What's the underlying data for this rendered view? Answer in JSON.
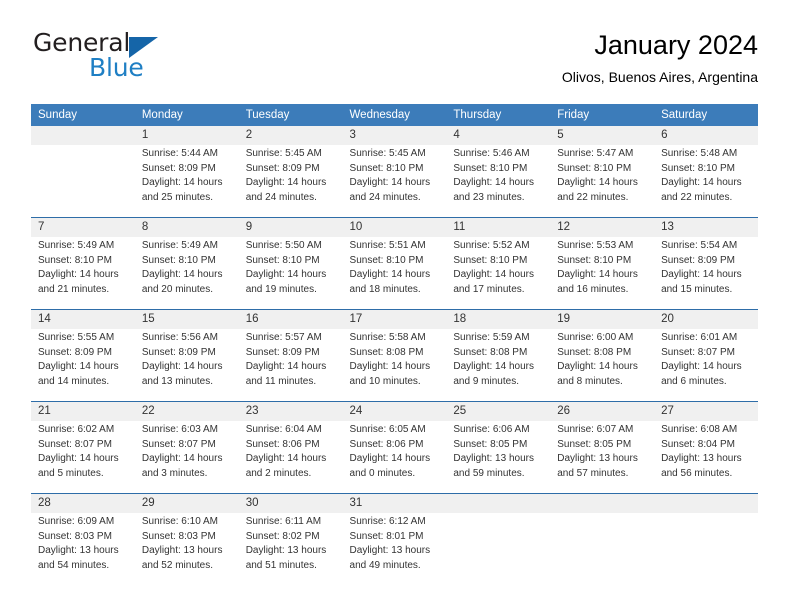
{
  "brand": {
    "name_part1": "General",
    "name_part2": "Blue",
    "triangle_color": "#1565a8",
    "blue_color": "#1f7fc4"
  },
  "header": {
    "title": "January 2024",
    "subtitle": "Olivos, Buenos Aires, Argentina"
  },
  "theme": {
    "header_bg": "#3c7cba",
    "daynum_bg": "#f0f0f0",
    "separator": "#2e6da8",
    "text": "#333333"
  },
  "columns": [
    "Sunday",
    "Monday",
    "Tuesday",
    "Wednesday",
    "Thursday",
    "Friday",
    "Saturday"
  ],
  "weeks": [
    {
      "days": [
        {
          "num": "",
          "sunrise": "",
          "sunset": "",
          "daylight_line1": "",
          "daylight_line2": ""
        },
        {
          "num": "1",
          "sunrise": "Sunrise: 5:44 AM",
          "sunset": "Sunset: 8:09 PM",
          "daylight_line1": "Daylight: 14 hours",
          "daylight_line2": "and 25 minutes."
        },
        {
          "num": "2",
          "sunrise": "Sunrise: 5:45 AM",
          "sunset": "Sunset: 8:09 PM",
          "daylight_line1": "Daylight: 14 hours",
          "daylight_line2": "and 24 minutes."
        },
        {
          "num": "3",
          "sunrise": "Sunrise: 5:45 AM",
          "sunset": "Sunset: 8:10 PM",
          "daylight_line1": "Daylight: 14 hours",
          "daylight_line2": "and 24 minutes."
        },
        {
          "num": "4",
          "sunrise": "Sunrise: 5:46 AM",
          "sunset": "Sunset: 8:10 PM",
          "daylight_line1": "Daylight: 14 hours",
          "daylight_line2": "and 23 minutes."
        },
        {
          "num": "5",
          "sunrise": "Sunrise: 5:47 AM",
          "sunset": "Sunset: 8:10 PM",
          "daylight_line1": "Daylight: 14 hours",
          "daylight_line2": "and 22 minutes."
        },
        {
          "num": "6",
          "sunrise": "Sunrise: 5:48 AM",
          "sunset": "Sunset: 8:10 PM",
          "daylight_line1": "Daylight: 14 hours",
          "daylight_line2": "and 22 minutes."
        }
      ]
    },
    {
      "days": [
        {
          "num": "7",
          "sunrise": "Sunrise: 5:49 AM",
          "sunset": "Sunset: 8:10 PM",
          "daylight_line1": "Daylight: 14 hours",
          "daylight_line2": "and 21 minutes."
        },
        {
          "num": "8",
          "sunrise": "Sunrise: 5:49 AM",
          "sunset": "Sunset: 8:10 PM",
          "daylight_line1": "Daylight: 14 hours",
          "daylight_line2": "and 20 minutes."
        },
        {
          "num": "9",
          "sunrise": "Sunrise: 5:50 AM",
          "sunset": "Sunset: 8:10 PM",
          "daylight_line1": "Daylight: 14 hours",
          "daylight_line2": "and 19 minutes."
        },
        {
          "num": "10",
          "sunrise": "Sunrise: 5:51 AM",
          "sunset": "Sunset: 8:10 PM",
          "daylight_line1": "Daylight: 14 hours",
          "daylight_line2": "and 18 minutes."
        },
        {
          "num": "11",
          "sunrise": "Sunrise: 5:52 AM",
          "sunset": "Sunset: 8:10 PM",
          "daylight_line1": "Daylight: 14 hours",
          "daylight_line2": "and 17 minutes."
        },
        {
          "num": "12",
          "sunrise": "Sunrise: 5:53 AM",
          "sunset": "Sunset: 8:10 PM",
          "daylight_line1": "Daylight: 14 hours",
          "daylight_line2": "and 16 minutes."
        },
        {
          "num": "13",
          "sunrise": "Sunrise: 5:54 AM",
          "sunset": "Sunset: 8:09 PM",
          "daylight_line1": "Daylight: 14 hours",
          "daylight_line2": "and 15 minutes."
        }
      ]
    },
    {
      "days": [
        {
          "num": "14",
          "sunrise": "Sunrise: 5:55 AM",
          "sunset": "Sunset: 8:09 PM",
          "daylight_line1": "Daylight: 14 hours",
          "daylight_line2": "and 14 minutes."
        },
        {
          "num": "15",
          "sunrise": "Sunrise: 5:56 AM",
          "sunset": "Sunset: 8:09 PM",
          "daylight_line1": "Daylight: 14 hours",
          "daylight_line2": "and 13 minutes."
        },
        {
          "num": "16",
          "sunrise": "Sunrise: 5:57 AM",
          "sunset": "Sunset: 8:09 PM",
          "daylight_line1": "Daylight: 14 hours",
          "daylight_line2": "and 11 minutes."
        },
        {
          "num": "17",
          "sunrise": "Sunrise: 5:58 AM",
          "sunset": "Sunset: 8:08 PM",
          "daylight_line1": "Daylight: 14 hours",
          "daylight_line2": "and 10 minutes."
        },
        {
          "num": "18",
          "sunrise": "Sunrise: 5:59 AM",
          "sunset": "Sunset: 8:08 PM",
          "daylight_line1": "Daylight: 14 hours",
          "daylight_line2": "and 9 minutes."
        },
        {
          "num": "19",
          "sunrise": "Sunrise: 6:00 AM",
          "sunset": "Sunset: 8:08 PM",
          "daylight_line1": "Daylight: 14 hours",
          "daylight_line2": "and 8 minutes."
        },
        {
          "num": "20",
          "sunrise": "Sunrise: 6:01 AM",
          "sunset": "Sunset: 8:07 PM",
          "daylight_line1": "Daylight: 14 hours",
          "daylight_line2": "and 6 minutes."
        }
      ]
    },
    {
      "days": [
        {
          "num": "21",
          "sunrise": "Sunrise: 6:02 AM",
          "sunset": "Sunset: 8:07 PM",
          "daylight_line1": "Daylight: 14 hours",
          "daylight_line2": "and 5 minutes."
        },
        {
          "num": "22",
          "sunrise": "Sunrise: 6:03 AM",
          "sunset": "Sunset: 8:07 PM",
          "daylight_line1": "Daylight: 14 hours",
          "daylight_line2": "and 3 minutes."
        },
        {
          "num": "23",
          "sunrise": "Sunrise: 6:04 AM",
          "sunset": "Sunset: 8:06 PM",
          "daylight_line1": "Daylight: 14 hours",
          "daylight_line2": "and 2 minutes."
        },
        {
          "num": "24",
          "sunrise": "Sunrise: 6:05 AM",
          "sunset": "Sunset: 8:06 PM",
          "daylight_line1": "Daylight: 14 hours",
          "daylight_line2": "and 0 minutes."
        },
        {
          "num": "25",
          "sunrise": "Sunrise: 6:06 AM",
          "sunset": "Sunset: 8:05 PM",
          "daylight_line1": "Daylight: 13 hours",
          "daylight_line2": "and 59 minutes."
        },
        {
          "num": "26",
          "sunrise": "Sunrise: 6:07 AM",
          "sunset": "Sunset: 8:05 PM",
          "daylight_line1": "Daylight: 13 hours",
          "daylight_line2": "and 57 minutes."
        },
        {
          "num": "27",
          "sunrise": "Sunrise: 6:08 AM",
          "sunset": "Sunset: 8:04 PM",
          "daylight_line1": "Daylight: 13 hours",
          "daylight_line2": "and 56 minutes."
        }
      ]
    },
    {
      "days": [
        {
          "num": "28",
          "sunrise": "Sunrise: 6:09 AM",
          "sunset": "Sunset: 8:03 PM",
          "daylight_line1": "Daylight: 13 hours",
          "daylight_line2": "and 54 minutes."
        },
        {
          "num": "29",
          "sunrise": "Sunrise: 6:10 AM",
          "sunset": "Sunset: 8:03 PM",
          "daylight_line1": "Daylight: 13 hours",
          "daylight_line2": "and 52 minutes."
        },
        {
          "num": "30",
          "sunrise": "Sunrise: 6:11 AM",
          "sunset": "Sunset: 8:02 PM",
          "daylight_line1": "Daylight: 13 hours",
          "daylight_line2": "and 51 minutes."
        },
        {
          "num": "31",
          "sunrise": "Sunrise: 6:12 AM",
          "sunset": "Sunset: 8:01 PM",
          "daylight_line1": "Daylight: 13 hours",
          "daylight_line2": "and 49 minutes."
        },
        {
          "num": "",
          "sunrise": "",
          "sunset": "",
          "daylight_line1": "",
          "daylight_line2": ""
        },
        {
          "num": "",
          "sunrise": "",
          "sunset": "",
          "daylight_line1": "",
          "daylight_line2": ""
        },
        {
          "num": "",
          "sunrise": "",
          "sunset": "",
          "daylight_line1": "",
          "daylight_line2": ""
        }
      ]
    }
  ]
}
